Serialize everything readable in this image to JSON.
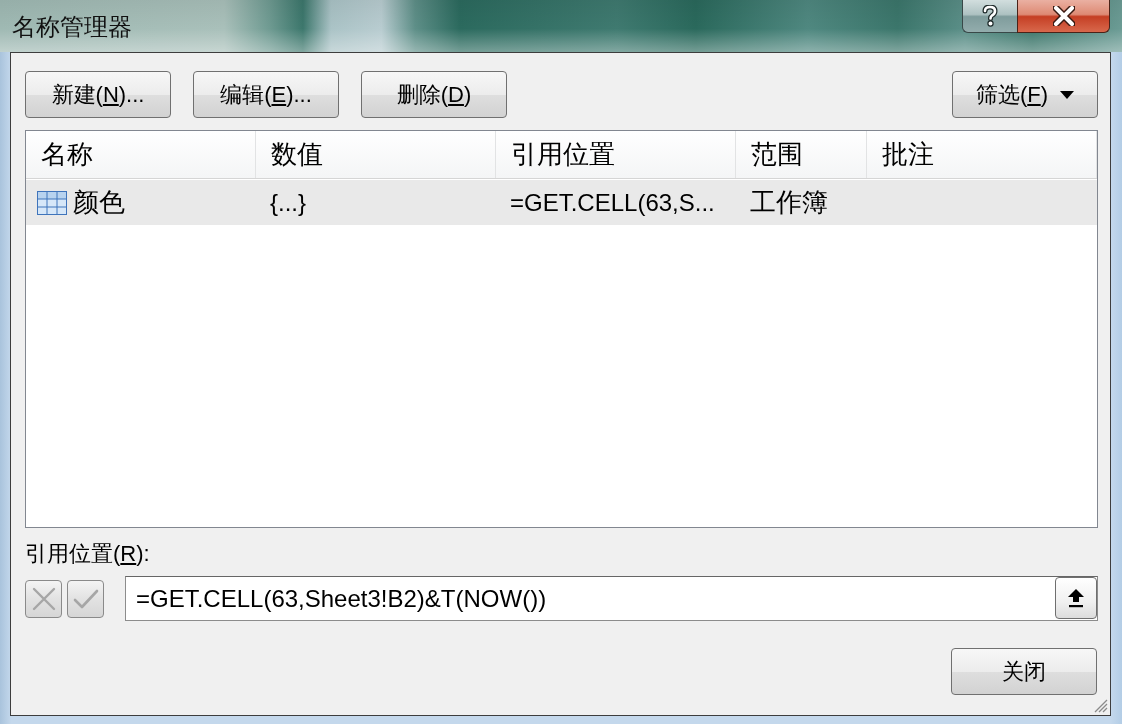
{
  "window": {
    "title": "名称管理器"
  },
  "toolbar": {
    "buttons": [
      {
        "text_before": "新建(",
        "access_key": "N",
        "text_after": ")..."
      },
      {
        "text_before": "编辑(",
        "access_key": "E",
        "text_after": ")..."
      },
      {
        "text_before": "删除(",
        "access_key": "D",
        "text_after": ")"
      }
    ],
    "filter_button": {
      "text_before": "筛选(",
      "access_key": "F",
      "text_after": ")"
    }
  },
  "names_list": {
    "columns": [
      "名称",
      "数值",
      "引用位置",
      "范围",
      "批注"
    ],
    "rows": [
      {
        "name": "颜色",
        "value": "{...}",
        "refers_to": "=GET.CELL(63,S...",
        "scope": "工作簿",
        "selected": true
      }
    ]
  },
  "refers_to": {
    "label": {
      "text_before": "引用位置(",
      "access_key": "R",
      "text_after": "):"
    },
    "cancel_button": {
      "disabled": true
    },
    "confirm_button": {
      "disabled": true
    },
    "value": "=GET.CELL(63,Sheet3!B2)&T(NOW())"
  },
  "buttons": [
    {
      "label": "关闭"
    }
  ]
}
